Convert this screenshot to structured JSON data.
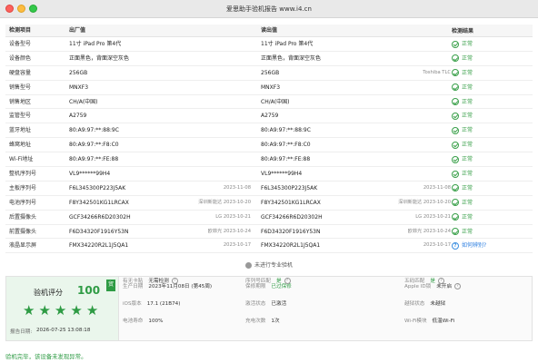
{
  "window": {
    "title": "爱思助手验机报告 www.i4.cn"
  },
  "table": {
    "headers": {
      "item": "检测项目",
      "factory": "出厂值",
      "read": "读出值",
      "result": "检测结果"
    },
    "rows": [
      {
        "item": "设备型号",
        "factory": "11寸 iPad Pro 第4代",
        "factory_extra": "",
        "read": "11寸 iPad Pro 第4代",
        "read_extra": "",
        "result": "正常"
      },
      {
        "item": "设备颜色",
        "factory": "正面黑色，背面深空灰色",
        "factory_extra": "",
        "read": "正面黑色，背面深空灰色",
        "read_extra": "",
        "result": "正常"
      },
      {
        "item": "硬盘容量",
        "factory": "256GB",
        "factory_extra": "",
        "read": "256GB",
        "read_extra": "Toshiba TLC",
        "result": "正常"
      },
      {
        "item": "销售型号",
        "factory": "MNXF3",
        "factory_extra": "",
        "read": "MNXF3",
        "read_extra": "",
        "result": "正常"
      },
      {
        "item": "销售地区",
        "factory": "CH/A(中国)",
        "factory_extra": "",
        "read": "CH/A(中国)",
        "read_extra": "",
        "result": "正常"
      },
      {
        "item": "监管型号",
        "factory": "A2759",
        "factory_extra": "",
        "read": "A2759",
        "read_extra": "",
        "result": "正常"
      },
      {
        "item": "蓝牙地址",
        "factory": "80:A9:97:**:88:9C",
        "factory_extra": "",
        "read": "80:A9:97:**:88:9C",
        "read_extra": "",
        "result": "正常"
      },
      {
        "item": "蜂窝地址",
        "factory": "80:A9:97:**:F8:C0",
        "factory_extra": "",
        "read": "80:A9:97:**:F8:C0",
        "read_extra": "",
        "result": "正常"
      },
      {
        "item": "Wi-Fi地址",
        "factory": "80:A9:97:**:FE:88",
        "factory_extra": "",
        "read": "80:A9:97:**:FE:88",
        "read_extra": "",
        "result": "正常"
      },
      {
        "item": "整机序列号",
        "factory": "VL9******99H4",
        "factory_extra": "",
        "read": "VL9******99H4",
        "read_extra": "",
        "result": "正常"
      },
      {
        "item": "主板序列号",
        "factory": "F6L345300P223J5AK",
        "factory_extra": "2023-11-08",
        "read": "F6L345300P223J5AK",
        "read_extra": "2023-11-08",
        "result": "正常"
      },
      {
        "item": "电池序列号",
        "factory": "F8Y342501KG1LRCAX",
        "factory_extra": "深圳新能达 2023-10-20",
        "read": "F8Y342501KG1LRCAX",
        "read_extra": "深圳新能达 2023-10-20",
        "result": "正常"
      },
      {
        "item": "后置摄像头",
        "factory": "GCF34266R6D20302H",
        "factory_extra": "LG 2023-10-21",
        "read": "GCF34266R6D20302H",
        "read_extra": "LG 2023-10-21",
        "result": "正常"
      },
      {
        "item": "前置摄像头",
        "factory": "F6D34320F1916Y53N",
        "factory_extra": "欧菲光 2023-10-24",
        "read": "F6D34320F1916Y53N",
        "read_extra": "欧菲光 2023-10-24",
        "result": "正常"
      },
      {
        "item": "液晶显示屏",
        "factory": "FMX34220R2L1J5QA1",
        "factory_extra": "2023-10-17",
        "read": "FMX34220R2L1J5QA1",
        "read_extra": "2023-10-17",
        "result": "如何辨别?",
        "result_type": "info"
      }
    ]
  },
  "gap_note": "未进行专业验机",
  "summary": {
    "score_label": "验机评分",
    "score": "100",
    "badge": "贸",
    "stars": [
      "★",
      "★",
      "★",
      "★",
      "★"
    ],
    "report_date_label": "报告日期:",
    "report_date": "2026-07-25 13:08:18",
    "fields": [
      {
        "key": "生产日期",
        "value": "2023年11月08日 (第45周)",
        "green": false,
        "q": false
      },
      {
        "key": "保修期限",
        "value": "已过保修",
        "green": true,
        "q": false
      },
      {
        "key": "Apple ID锁",
        "value": "未开启",
        "green": false,
        "q": true
      },
      {
        "key": "iOS版本",
        "value": "17.1 (21B74)",
        "green": false,
        "q": false
      },
      {
        "key": "激活状态",
        "value": "已激活",
        "green": false,
        "q": false
      },
      {
        "key": "越狱状态",
        "value": "未越狱",
        "green": false,
        "q": false
      },
      {
        "key": "电池寿命",
        "value": "100%",
        "green": false,
        "q": false
      },
      {
        "key": "充电次数",
        "value": "1次",
        "green": false,
        "q": false
      },
      {
        "key": "Wi-Fi模块",
        "value": "低温Wi-Fi",
        "green": false,
        "q": false
      },
      {
        "key": "有无卡贴",
        "value": "无需检测",
        "green": false,
        "q": true
      },
      {
        "key": "序列号匹配",
        "value": "是",
        "green": true,
        "q": true
      },
      {
        "key": "五码匹配",
        "value": "是",
        "green": true,
        "q": true
      }
    ]
  },
  "footer": "验机完毕，该设备未发现异常。"
}
